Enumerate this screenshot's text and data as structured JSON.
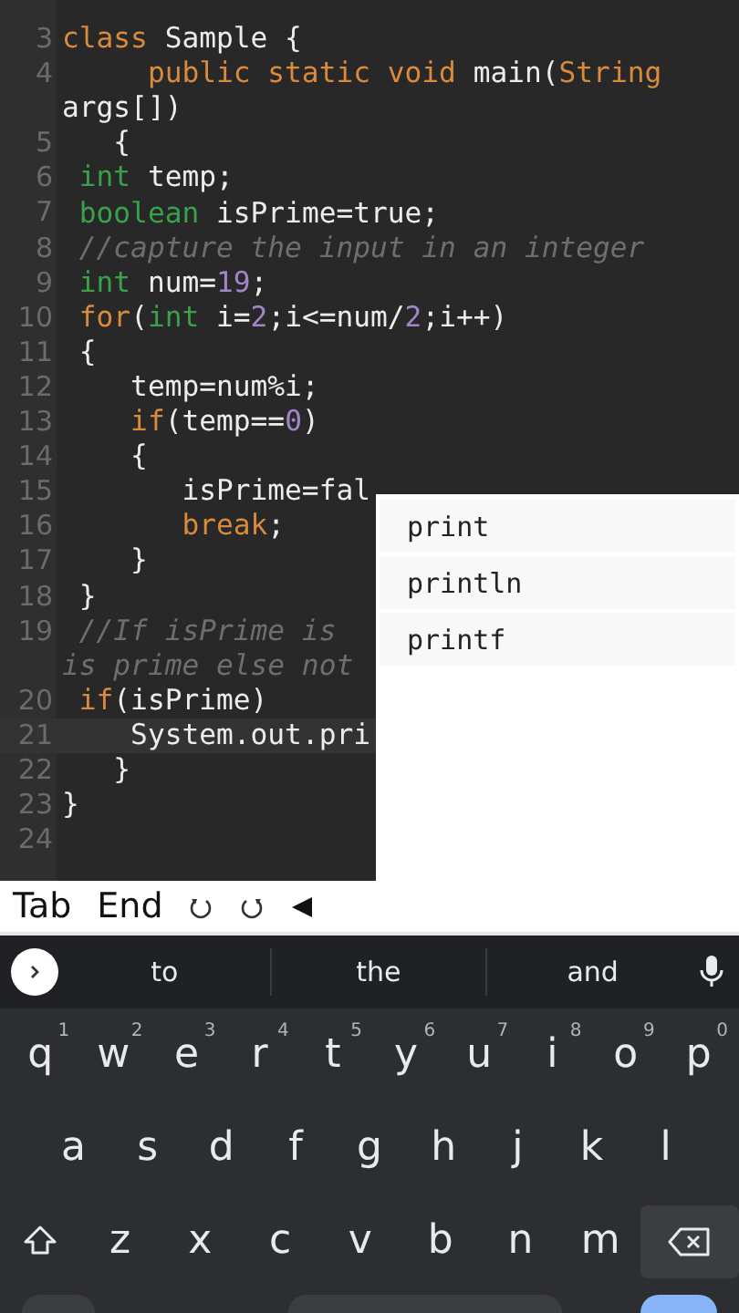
{
  "editor": {
    "lines": [
      {
        "number": "3",
        "tokens": [
          {
            "kind": "keyword",
            "text": "class"
          },
          {
            "kind": "plain",
            "text": " Sample {"
          }
        ]
      },
      {
        "number": "4",
        "tokens": [
          {
            "kind": "keyword",
            "text": "     public static void"
          },
          {
            "kind": "plain",
            "text": " main("
          },
          {
            "kind": "keyword",
            "text": "String"
          }
        ]
      },
      {
        "tokens": [
          {
            "kind": "plain",
            "text": "args[])"
          }
        ]
      },
      {
        "number": "5",
        "tokens": [
          {
            "kind": "plain",
            "text": "   {"
          }
        ]
      },
      {
        "number": "6",
        "tokens": [
          {
            "kind": "type",
            "text": " int"
          },
          {
            "kind": "plain",
            "text": " temp;"
          }
        ]
      },
      {
        "number": "7",
        "tokens": [
          {
            "kind": "type",
            "text": " boolean"
          },
          {
            "kind": "plain",
            "text": " isPrime=true;"
          }
        ]
      },
      {
        "number": "8",
        "tokens": [
          {
            "kind": "comment",
            "text": " //capture the input in an integer"
          }
        ]
      },
      {
        "number": "9",
        "tokens": [
          {
            "kind": "type",
            "text": " int"
          },
          {
            "kind": "plain",
            "text": " num="
          },
          {
            "kind": "number",
            "text": "19"
          },
          {
            "kind": "plain",
            "text": ";"
          }
        ]
      },
      {
        "number": "10",
        "tokens": [
          {
            "kind": "keyword",
            "text": " for"
          },
          {
            "kind": "plain",
            "text": "("
          },
          {
            "kind": "type",
            "text": "int"
          },
          {
            "kind": "plain",
            "text": " i="
          },
          {
            "kind": "number",
            "text": "2"
          },
          {
            "kind": "plain",
            "text": ";i<=num/"
          },
          {
            "kind": "number",
            "text": "2"
          },
          {
            "kind": "plain",
            "text": ";i++)"
          }
        ]
      },
      {
        "number": "11",
        "tokens": [
          {
            "kind": "plain",
            "text": " {"
          }
        ]
      },
      {
        "number": "12",
        "tokens": [
          {
            "kind": "plain",
            "text": "    temp=num%i;"
          }
        ]
      },
      {
        "number": "13",
        "tokens": [
          {
            "kind": "keyword",
            "text": "    if"
          },
          {
            "kind": "plain",
            "text": "(temp=="
          },
          {
            "kind": "number",
            "text": "0"
          },
          {
            "kind": "plain",
            "text": ")"
          }
        ]
      },
      {
        "number": "14",
        "tokens": [
          {
            "kind": "plain",
            "text": "    {"
          }
        ]
      },
      {
        "number": "15",
        "tokens": [
          {
            "kind": "plain",
            "text": "       isPrime=fal"
          }
        ]
      },
      {
        "number": "16",
        "tokens": [
          {
            "kind": "keyword",
            "text": "       break"
          },
          {
            "kind": "plain",
            "text": ";"
          }
        ]
      },
      {
        "number": "17",
        "tokens": [
          {
            "kind": "plain",
            "text": "    }"
          }
        ]
      },
      {
        "number": "18",
        "tokens": [
          {
            "kind": "plain",
            "text": " }"
          }
        ]
      },
      {
        "number": "19",
        "tokens": [
          {
            "kind": "comment",
            "text": " //If isPrime is"
          }
        ]
      },
      {
        "tokens": [
          {
            "kind": "comment",
            "text": "is prime else not"
          }
        ]
      },
      {
        "number": "20",
        "tokens": [
          {
            "kind": "keyword",
            "text": " if"
          },
          {
            "kind": "plain",
            "text": "(isPrime)"
          }
        ]
      },
      {
        "number": "21",
        "current": true,
        "tokens": [
          {
            "kind": "plain",
            "text": "    System.out.pri"
          }
        ]
      },
      {
        "number": "22",
        "tokens": [
          {
            "kind": "plain",
            "text": "   }"
          }
        ]
      },
      {
        "number": "23",
        "tokens": [
          {
            "kind": "plain",
            "text": "}"
          }
        ]
      },
      {
        "number": "24"
      }
    ]
  },
  "suggestions": [
    "print",
    "println",
    "printf"
  ],
  "toolbar": [
    {
      "kind": "text",
      "label": "Tab"
    },
    {
      "kind": "text",
      "label": "End"
    },
    {
      "kind": "undo"
    },
    {
      "kind": "redo"
    },
    {
      "kind": "left"
    }
  ],
  "keyboard": {
    "words": [
      "to",
      "the",
      "and"
    ],
    "rows": [
      [
        {
          "letter": "q",
          "hint": "1"
        },
        {
          "letter": "w",
          "hint": "2"
        },
        {
          "letter": "e",
          "hint": "3"
        },
        {
          "letter": "r",
          "hint": "4"
        },
        {
          "letter": "t",
          "hint": "5"
        },
        {
          "letter": "y",
          "hint": "6"
        },
        {
          "letter": "u",
          "hint": "7"
        },
        {
          "letter": "i",
          "hint": "8"
        },
        {
          "letter": "o",
          "hint": "9"
        },
        {
          "letter": "p",
          "hint": "0"
        }
      ],
      [
        {
          "letter": "a"
        },
        {
          "letter": "s"
        },
        {
          "letter": "d"
        },
        {
          "letter": "f"
        },
        {
          "letter": "g"
        },
        {
          "letter": "h"
        },
        {
          "letter": "j"
        },
        {
          "letter": "k"
        },
        {
          "letter": "l"
        }
      ],
      [
        {
          "letter": "z"
        },
        {
          "letter": "x"
        },
        {
          "letter": "c"
        },
        {
          "letter": "v"
        },
        {
          "letter": "b"
        },
        {
          "letter": "n"
        },
        {
          "letter": "m"
        }
      ]
    ]
  }
}
